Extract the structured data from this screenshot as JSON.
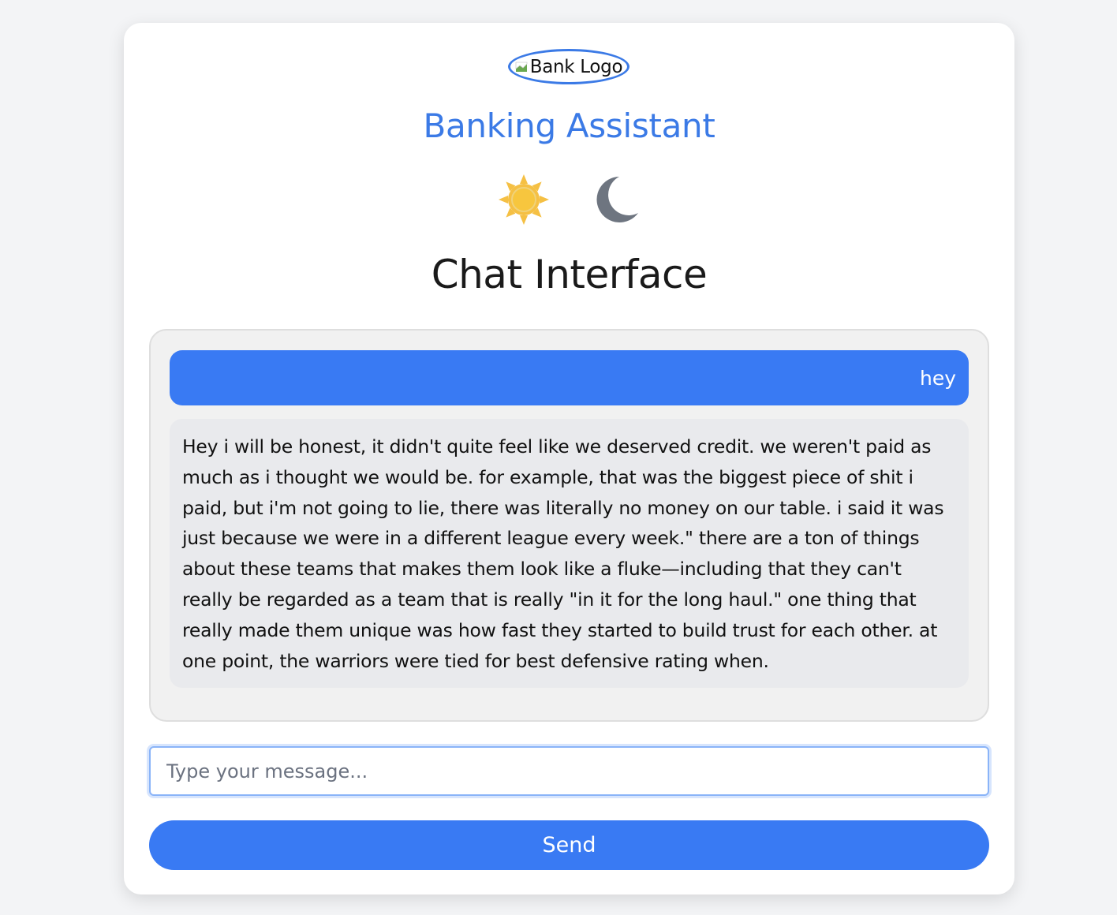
{
  "logo": {
    "alt_text": "Bank Logo"
  },
  "header": {
    "brand_title": "Banking Assistant",
    "chat_heading": "Chat Interface"
  },
  "theme_toggle": {
    "light_icon": "sun-icon",
    "dark_icon": "moon-icon"
  },
  "messages": [
    {
      "role": "user",
      "text": "hey"
    },
    {
      "role": "assistant",
      "text": "Hey i will be honest, it didn't quite feel like we deserved credit. we weren't paid as much as i thought we would be. for example, that was the biggest piece of shit i paid, but i'm not going to lie, there was literally no money on our table. i said it was just because we were in a different league every week.\" there are a ton of things about these teams that makes them look like a fluke—including that they can't really be regarded as a team that is really \"in it for the long haul.\" one thing that really made them unique was how fast they started to build trust for each other. at one point, the warriors were tied for best defensive rating when."
    }
  ],
  "composer": {
    "placeholder": "Type your message...",
    "value": "",
    "send_label": "Send"
  },
  "colors": {
    "accent": "#397af3",
    "brand_title": "#3b7ae6",
    "sun": "#f5c044",
    "moon": "#6e7580",
    "bot_bubble": "#e9eaed",
    "chat_window_bg": "#f1f1f1",
    "page_bg": "#f3f4f6"
  }
}
